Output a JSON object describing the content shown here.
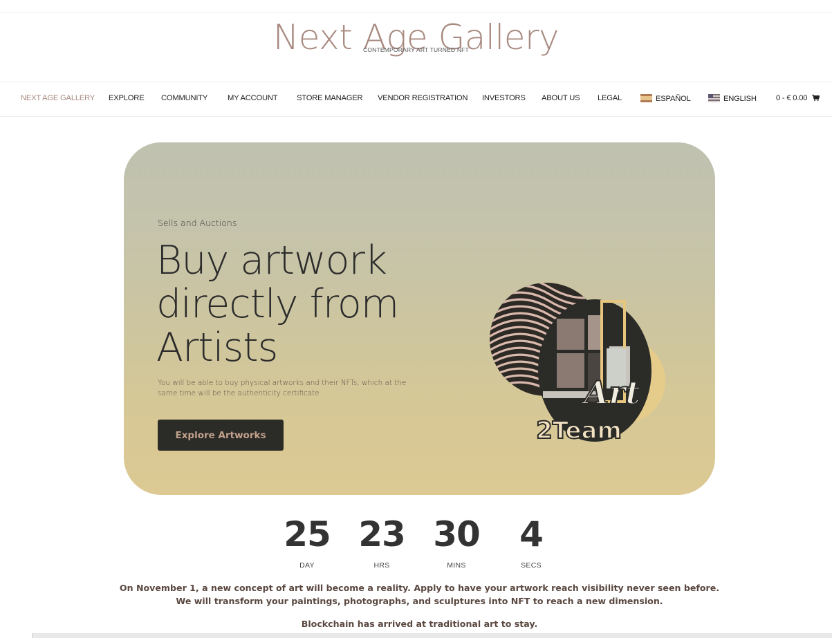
{
  "header": {
    "site_title": "Next Age Gallery",
    "tagline": "CONTEMPORARY ART TURNED NFT"
  },
  "nav": {
    "items": [
      {
        "label": "NEXT AGE GALLERY",
        "active": true
      },
      {
        "label": "EXPLORE"
      },
      {
        "label": "COMMUNITY"
      },
      {
        "label": "MY ACCOUNT"
      },
      {
        "label": "STORE MANAGER"
      },
      {
        "label": "VENDOR REGISTRATION"
      },
      {
        "label": "INVESTORS"
      },
      {
        "label": "ABOUT US"
      },
      {
        "label": "LEGAL"
      },
      {
        "label": "ESPAÑOL",
        "icon": "spain-flag-icon"
      },
      {
        "label": "ENGLISH",
        "icon": "uk-flag-icon"
      }
    ],
    "cart": {
      "label": "0 - € 0.00",
      "icon": "shopping-cart-icon"
    }
  },
  "hero": {
    "eyebrow": "Sells and Auctions",
    "headline": [
      "Buy artwork",
      "directly from",
      "Artists"
    ],
    "description": "You will be able to buy physical artworks and their NFTs, which at the same time will be the authenticity certificate",
    "cta_label": "Explore Artworks",
    "logo_text": [
      "Art",
      "2Team"
    ]
  },
  "countdown": [
    {
      "value": "25",
      "label": "DAY"
    },
    {
      "value": "23",
      "label": "HRS"
    },
    {
      "value": "30",
      "label": "MINS"
    },
    {
      "value": "4",
      "label": "SECS"
    }
  ],
  "content": {
    "paragraph1": "On November 1, a new concept of art will become a reality. Apply to have your artwork reach visibility never seen before. We will transform your paintings, photographs, and sculptures into NFT to reach a new dimension.",
    "paragraph2": "Blockchain has arrived at traditional art to stay."
  },
  "colors": {
    "brand": "#a88a80",
    "cta_background": "#2b2b27",
    "cta_text": "#c2a08c",
    "hero_top": "#bfc2b0",
    "hero_bottom": "#dcc993"
  }
}
